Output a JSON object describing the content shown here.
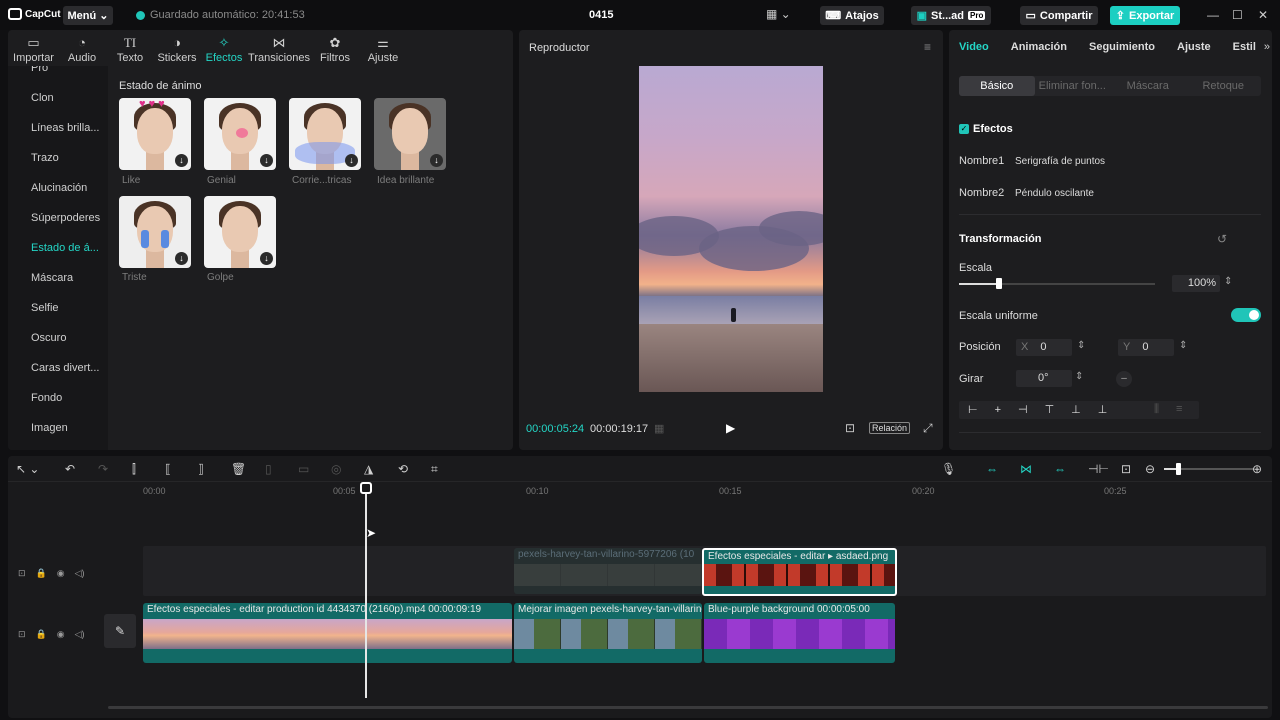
{
  "titlebar": {
    "app_name": "CapCut",
    "menu_label": "Menú",
    "autosave": "Guardado automático: 20:41:53",
    "project_name": "0415",
    "shortcuts_label": "Atajos",
    "studio_label": "St...ad",
    "pro_badge": "Pro",
    "share_label": "Compartir",
    "export_label": "Exportar"
  },
  "toolbar": {
    "items": [
      {
        "label": "Importar",
        "icon": "import-icon"
      },
      {
        "label": "Audio",
        "icon": "audio-icon"
      },
      {
        "label": "Texto",
        "icon": "text-icon"
      },
      {
        "label": "Stickers",
        "icon": "sticker-icon"
      },
      {
        "label": "Efectos",
        "icon": "effects-icon"
      },
      {
        "label": "Transiciones",
        "icon": "transitions-icon"
      },
      {
        "label": "Filtros",
        "icon": "filters-icon"
      },
      {
        "label": "Ajuste",
        "icon": "adjust-icon"
      }
    ]
  },
  "categories": [
    "Pro",
    "Clon",
    "Líneas brilla...",
    "Trazo",
    "Alucinación",
    "Súperpoderes",
    "Estado de á...",
    "Máscara",
    "Selfie",
    "Oscuro",
    "Caras divert...",
    "Fondo",
    "Imagen"
  ],
  "effects_grid": {
    "title": "Estado de ánimo",
    "items": [
      "Like",
      "Genial",
      "Corrie...tricas",
      "Idea brillante",
      "Triste",
      "Golpe"
    ]
  },
  "player": {
    "title": "Reproductor",
    "current_time": "00:00:05:24",
    "total_time": "00:00:19:17",
    "ratio_label": "Relación"
  },
  "right_panel": {
    "tabs": [
      "Video",
      "Animación",
      "Seguimiento",
      "Ajuste",
      "Estil"
    ],
    "subtabs": [
      "Básico",
      "Eliminar fon...",
      "Máscara",
      "Retoque"
    ],
    "effects_section": "Efectos",
    "name1_label": "Nombre1",
    "name1_value": "Serigrafía de puntos",
    "name2_label": "Nombre2",
    "name2_value": "Péndulo oscilante",
    "transform_section": "Transformación",
    "scale_label": "Escala",
    "scale_value": "100%",
    "uniform_scale_label": "Escala uniforme",
    "position_label": "Posición",
    "pos_x_label": "X",
    "pos_x_value": "0",
    "pos_y_label": "Y",
    "pos_y_value": "0",
    "rotate_label": "Girar",
    "rotate_value": "0°"
  },
  "timeline": {
    "ruler": [
      "00:00",
      "00:05",
      "00:10",
      "00:15",
      "00:20",
      "00:25"
    ],
    "overlay_clips": [
      {
        "title": "pexels-harvey-tan-villarino-5977206 (10"
      },
      {
        "title": "Efectos especiales - editar ▸  asdaed.png"
      }
    ],
    "main_clips": [
      {
        "title": "Efectos especiales - editar   production id 4434370 (2160p).mp4   00:00:09:19"
      },
      {
        "title": "Mejorar imagen   pexels-harvey-tan-villarino"
      },
      {
        "title": "Blue-purple background   00:00:05:00"
      }
    ]
  },
  "colors": {
    "accent": "#1ccfc2",
    "panel": "#1d1d1f",
    "background": "#101012"
  }
}
